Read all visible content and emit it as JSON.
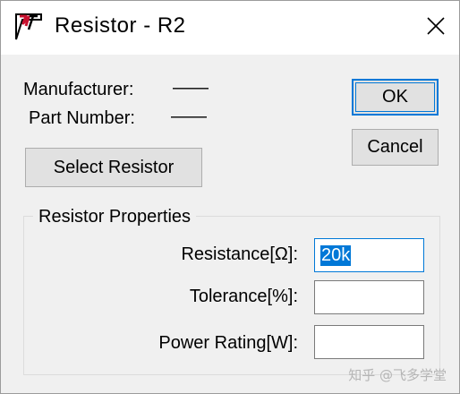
{
  "window": {
    "title": "Resistor - R2",
    "icon": "ltspice-icon"
  },
  "info": {
    "manufacturer_label": "Manufacturer:",
    "manufacturer_value": "——",
    "part_number_label": "Part Number:",
    "part_number_value": "——"
  },
  "buttons": {
    "ok": "OK",
    "cancel": "Cancel",
    "select_resistor": "Select Resistor"
  },
  "properties": {
    "group_title": "Resistor Properties",
    "resistance_label": "Resistance[Ω]:",
    "resistance_value": "20k",
    "tolerance_label": "Tolerance[%]:",
    "tolerance_value": "",
    "power_label": "Power Rating[W]:",
    "power_value": ""
  },
  "watermark": "知乎 @飞多学堂",
  "colors": {
    "accent": "#0078d7",
    "icon_red": "#c8102e"
  }
}
